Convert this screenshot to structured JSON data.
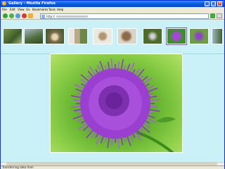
{
  "window": {
    "title": "Gallery - Mozilla Firefox",
    "controls": {
      "minimize": "_",
      "maximize": "□",
      "close": "×"
    }
  },
  "menu": [
    "File",
    "Edit",
    "View",
    "Go",
    "Bookmarks",
    "Tools",
    "Help"
  ],
  "navigation": {
    "url_prefix": "http://",
    "buttons": [
      "back-icon",
      "forward-icon",
      "reload-icon",
      "stop-icon",
      "home-icon"
    ]
  },
  "gallery": {
    "thumbnails": [
      "thumb-1",
      "thumb-2",
      "thumb-3",
      "thumb-4",
      "thumb-5",
      "thumb-6",
      "thumb-7",
      "thumb-8",
      "thumb-9",
      "thumb-10"
    ],
    "selected_index": 7
  },
  "status": {
    "text": "Transferring data from"
  },
  "colors": {
    "content_background": "#c9f1f7",
    "title_bar": "#0a5de8",
    "flower": "#9b3fd0",
    "grass": "#62b22f"
  }
}
